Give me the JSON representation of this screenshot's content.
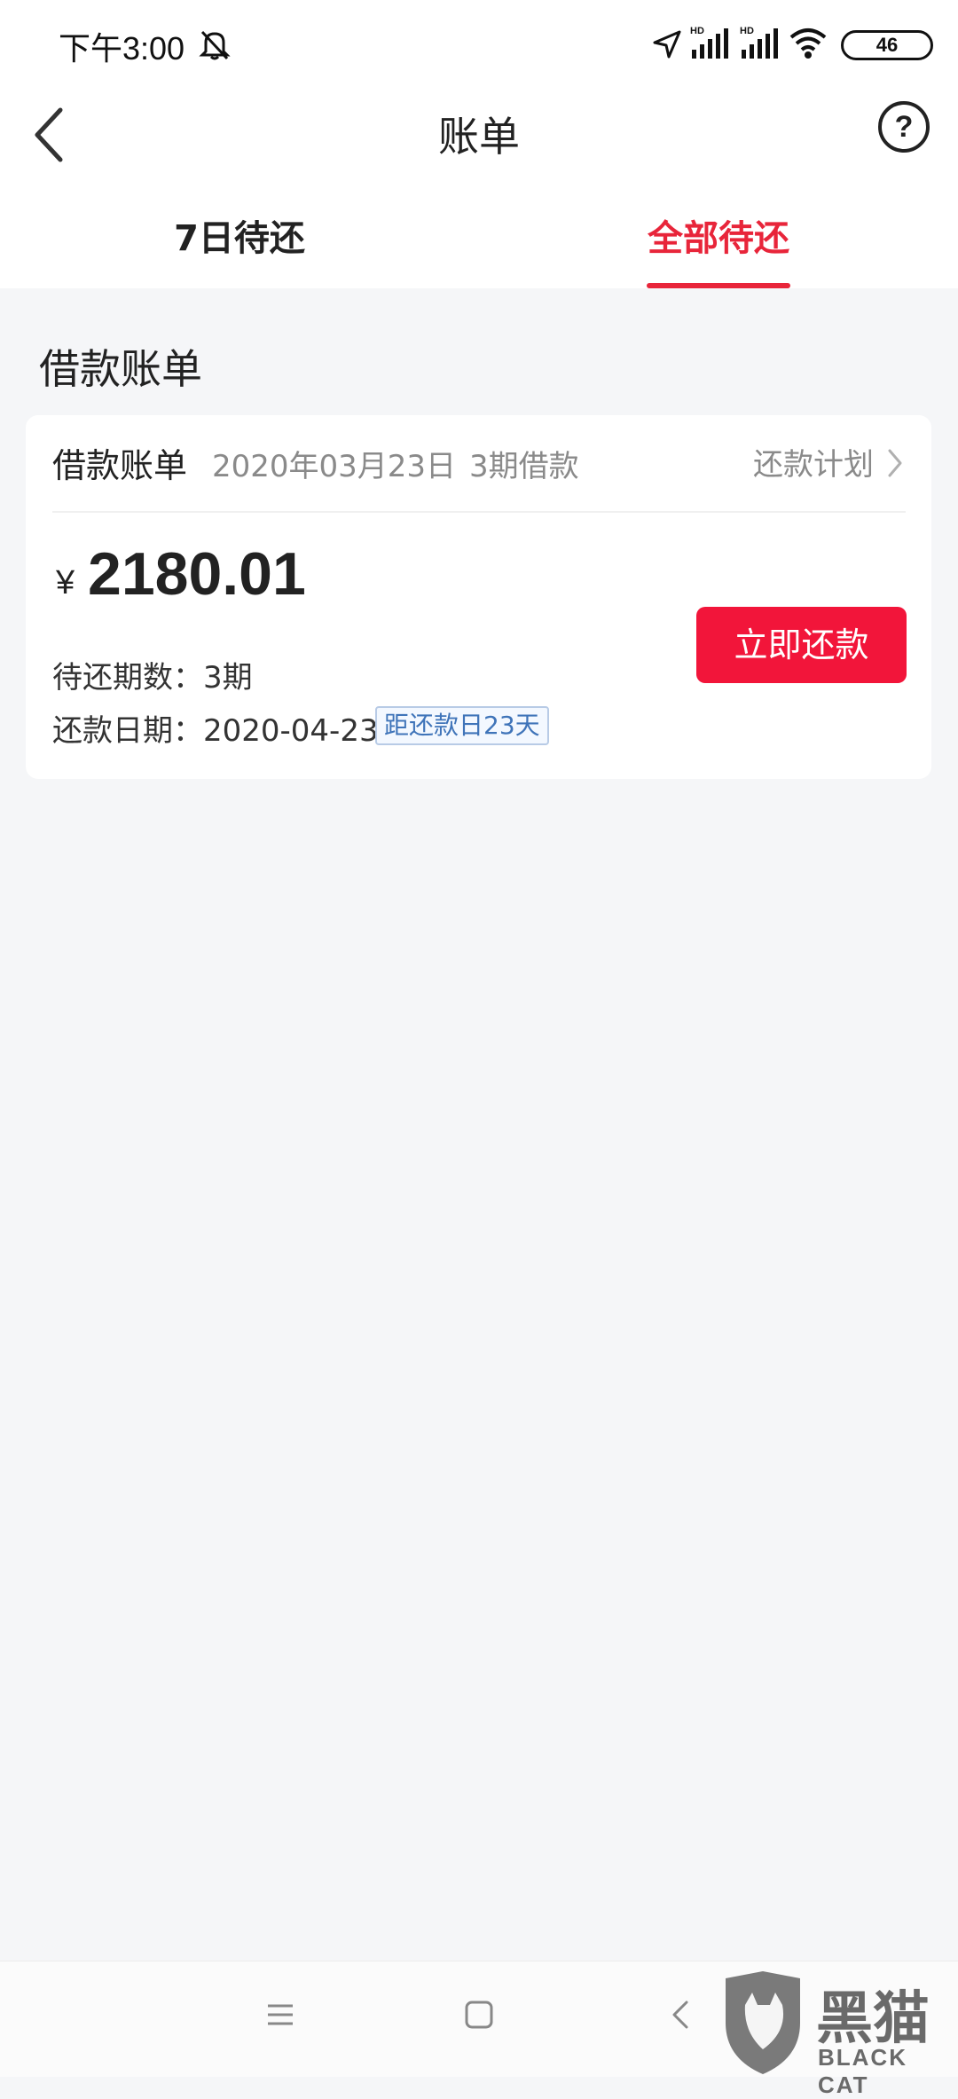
{
  "status_bar": {
    "time": "下午3:00",
    "battery": "46",
    "icons": [
      "mute-icon",
      "location-icon",
      "signal-hd-icon",
      "signal-hd-icon",
      "wifi-icon",
      "battery-icon"
    ]
  },
  "nav": {
    "title": "账单",
    "back_icon": "chevron-left-icon",
    "help_label": "?"
  },
  "tabs": [
    {
      "label": "7日待还",
      "active": false
    },
    {
      "label": "全部待还",
      "active": true
    }
  ],
  "section": {
    "title": "借款账单"
  },
  "bill_card": {
    "type": "借款账单",
    "date": "2020年03月23日",
    "periods": "3期借款",
    "plan_link": "还款计划",
    "currency": "¥",
    "amount": "2180.01",
    "pending_label": "待还期数：",
    "pending_value": "3期",
    "due_label": "还款日期：",
    "due_value": "2020-04-23",
    "countdown": "距还款日23天",
    "repay_button": "立即还款"
  },
  "colors": {
    "accent": "#e8253a",
    "button": "#f2153a",
    "background": "#f5f6f8",
    "badge_text": "#3f74b9"
  },
  "watermark": {
    "cn": "黑猫",
    "en": "BLACK CAT"
  }
}
